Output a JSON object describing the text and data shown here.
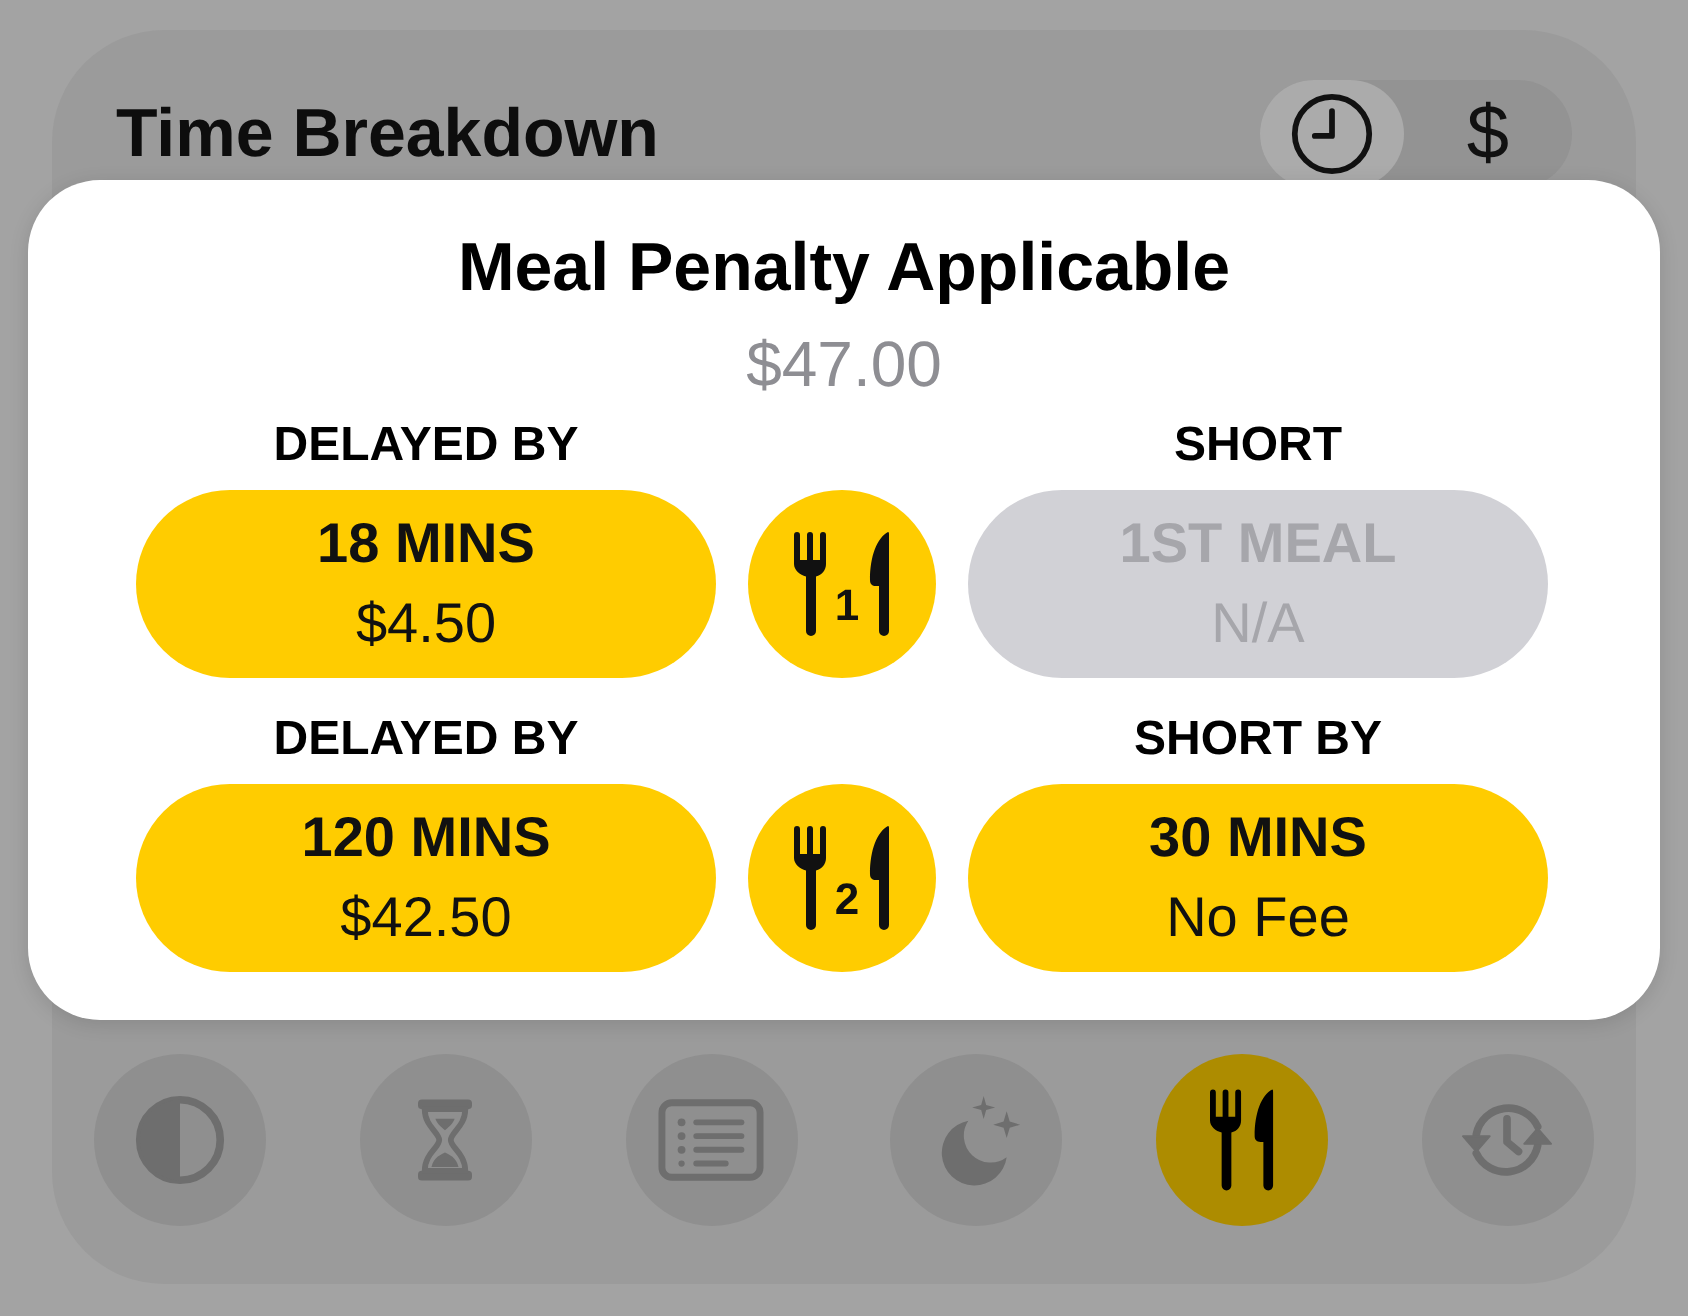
{
  "header": {
    "title": "Time Breakdown",
    "segments": [
      {
        "kind": "clock",
        "selected": true
      },
      {
        "kind": "text",
        "label": "$",
        "selected": false
      }
    ]
  },
  "dialog": {
    "title": "Meal Penalty Applicable",
    "total": "$47.00",
    "meals": [
      {
        "number": "1",
        "delay": {
          "label": "DELAYED BY",
          "duration": "18 MINS",
          "fee": "$4.50",
          "disabled": false
        },
        "short": {
          "label": "SHORT",
          "duration": "1ST MEAL",
          "fee": "N/A",
          "disabled": true
        }
      },
      {
        "number": "2",
        "delay": {
          "label": "DELAYED BY",
          "duration": "120 MINS",
          "fee": "$42.50",
          "disabled": false
        },
        "short": {
          "label": "SHORT BY",
          "duration": "30 MINS",
          "fee": "No Fee",
          "disabled": false
        }
      }
    ]
  },
  "toolbar": [
    {
      "kind": "contrast",
      "selected": false
    },
    {
      "kind": "hourglass",
      "selected": false
    },
    {
      "kind": "list",
      "selected": false
    },
    {
      "kind": "moon",
      "selected": false
    },
    {
      "kind": "meal",
      "selected": true
    },
    {
      "kind": "history",
      "selected": false
    }
  ]
}
